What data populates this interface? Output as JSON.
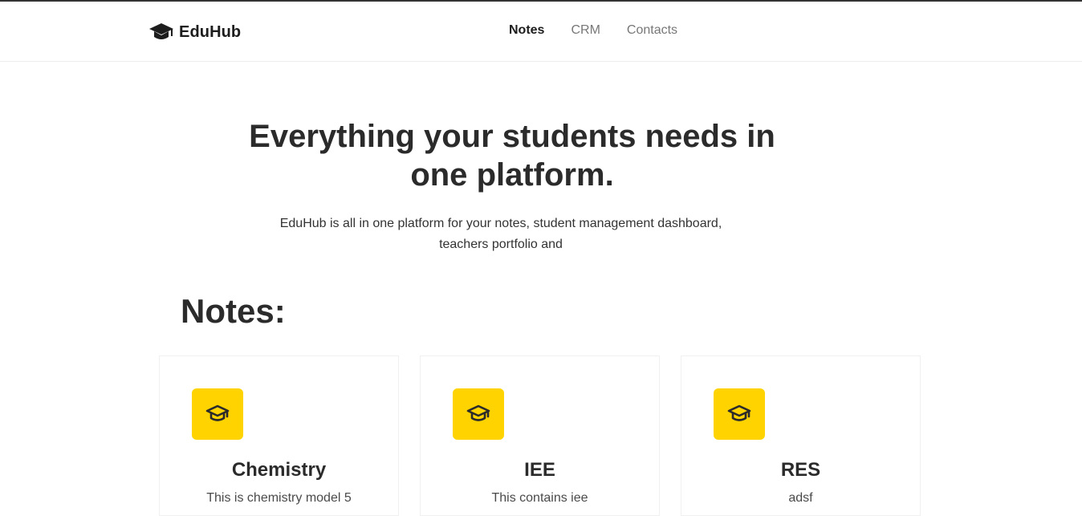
{
  "navbar": {
    "brand": "EduHub",
    "brand_icon": "graduation-cap-icon",
    "links": [
      {
        "label": "Notes",
        "active": true
      },
      {
        "label": "CRM",
        "active": false
      },
      {
        "label": "Contacts",
        "active": false
      }
    ]
  },
  "hero": {
    "title_part1": "Everything your students needs in",
    "title_part2": "one",
    "title_highlight": "platform",
    "title_end": ".",
    "subtitle": "EduHub is all in one platform for your notes, student management dashboard, teachers portfolio and"
  },
  "notes": {
    "heading": "Notes:",
    "cards": [
      {
        "title": "Chemistry",
        "description": "This is chemistry model 5",
        "icon": "graduation-cap-icon"
      },
      {
        "title": "IEE",
        "description": "This contains iee",
        "icon": "graduation-cap-icon"
      },
      {
        "title": "RES",
        "description": "adsf",
        "icon": "graduation-cap-icon"
      }
    ]
  },
  "colors": {
    "accent": "#ffd300",
    "text": "#2b2b2b",
    "nav_inactive": "#777777"
  }
}
